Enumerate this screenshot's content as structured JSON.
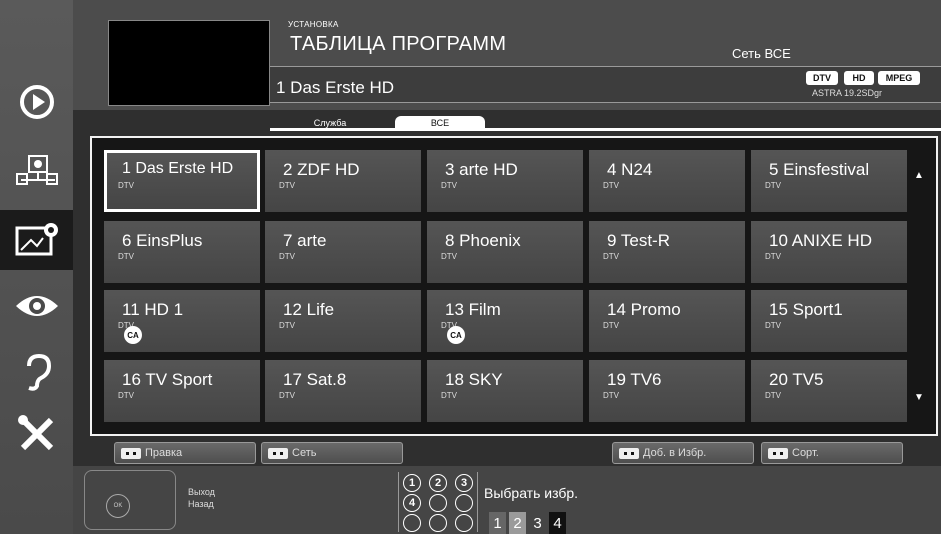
{
  "header": {
    "subtitle": "УСТАНОВКА",
    "title": "ТАБЛИЦА ПРОГРАММ",
    "network": "Сеть ВСЕ",
    "current_channel": "1  Das Erste HD",
    "badges": [
      "DTV",
      "HD",
      "MPEG"
    ],
    "satellite": "ASTRA 19.2SDgr"
  },
  "tabs": [
    {
      "label": "Служба",
      "active": false
    },
    {
      "label": "ВСЕ",
      "active": true
    }
  ],
  "channels": [
    {
      "name": "1  Das Erste HD",
      "type": "DTV",
      "ca": false,
      "selected": true
    },
    {
      "name": "2  ZDF HD",
      "type": "DTV",
      "ca": false
    },
    {
      "name": "3  arte HD",
      "type": "DTV",
      "ca": false
    },
    {
      "name": "4   N24",
      "type": "DTV",
      "ca": false
    },
    {
      "name": "5  Einsfestival",
      "type": "DTV",
      "ca": false
    },
    {
      "name": "6  EinsPlus",
      "type": "DTV",
      "ca": false
    },
    {
      "name": "7  arte",
      "type": "DTV",
      "ca": false
    },
    {
      "name": "8  Phoenix",
      "type": "DTV",
      "ca": false
    },
    {
      "name": "9  Test-R",
      "type": "DTV",
      "ca": false
    },
    {
      "name": "10  ANIXE HD",
      "type": "DTV",
      "ca": false
    },
    {
      "name": "11   HD 1",
      "type": "DTV",
      "ca": true
    },
    {
      "name": "12   Life",
      "type": "DTV",
      "ca": false
    },
    {
      "name": "13   Film",
      "type": "DTV",
      "ca": true
    },
    {
      "name": "14   Promo",
      "type": "DTV",
      "ca": false
    },
    {
      "name": "15   Sport1",
      "type": "DTV",
      "ca": false
    },
    {
      "name": "16   TV Sport",
      "type": "DTV",
      "ca": false
    },
    {
      "name": "17   Sat.8",
      "type": "DTV",
      "ca": false
    },
    {
      "name": "18   SKY",
      "type": "DTV",
      "ca": false
    },
    {
      "name": "19   TV6",
      "type": "DTV",
      "ca": false
    },
    {
      "name": "20   TV5",
      "type": "DTV",
      "ca": false
    }
  ],
  "ca_label": "CA",
  "function_buttons": {
    "edit": "Правка",
    "network": "Сеть",
    "add_fav": "Доб. в Избр.",
    "sort": "Сорт."
  },
  "remote": {
    "ok": "OK",
    "exit": "Выход",
    "back": "Назад"
  },
  "favorites": {
    "label": "Выбрать избр.",
    "digits": [
      "1",
      "2",
      "3",
      "4"
    ],
    "pages": [
      "1",
      "2",
      "3",
      "4"
    ],
    "active_page": "2"
  },
  "colors": {
    "background": "#2f2f2f",
    "cell": "#505050",
    "grid_border": "#f2f2f2"
  },
  "icons": [
    "play-source-icon",
    "network-icon",
    "program-table-icon",
    "eye-icon",
    "audio-icon",
    "tools-icon",
    "scroll-up-icon",
    "scroll-down-icon"
  ]
}
